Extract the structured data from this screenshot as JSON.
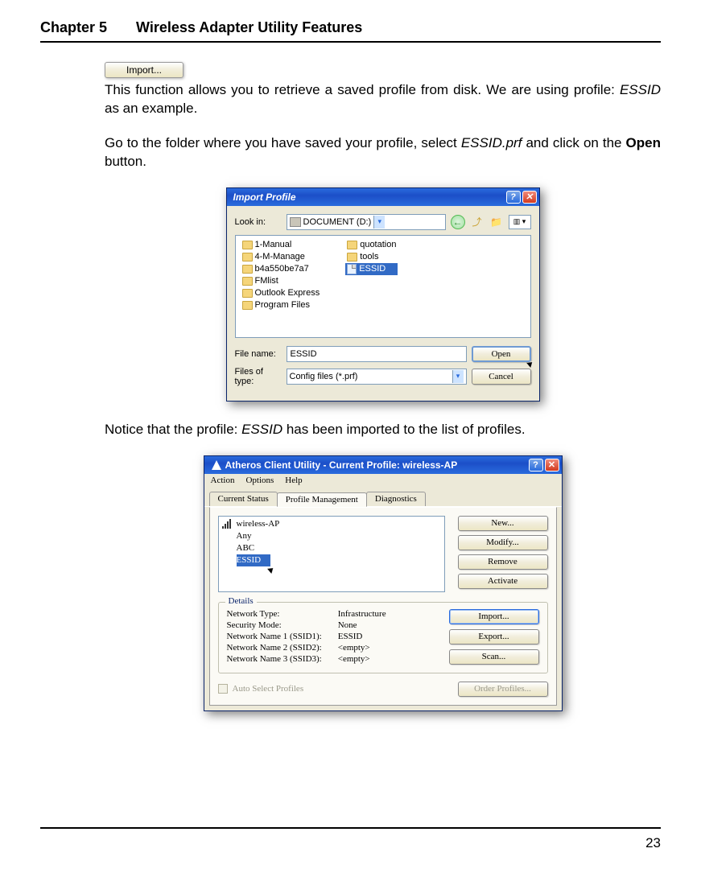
{
  "header": {
    "chapter": "Chapter 5",
    "title": "Wireless Adapter Utility Features"
  },
  "importButton": {
    "label": "Import..."
  },
  "para1": {
    "t1": "This function allows you to retrieve a saved profile from disk. We are using profile: ",
    "essid": "ESSID",
    "t2": " as an example."
  },
  "para2": {
    "t1": "Go to the folder where you have saved your profile, select ",
    "file": "ESSID.prf",
    "t2": " and click on the ",
    "open": "Open",
    "t3": " button."
  },
  "dlg_import": {
    "title": "Import Profile",
    "look_in_lbl": "Look in:",
    "look_in_value": "DOCUMENT (D:)",
    "nav": {
      "view_label": "▥ ▾"
    },
    "files_col1": [
      "1-Manual",
      "4-M-Manage",
      "b4a550be7a7",
      "FMlist",
      "Outlook Express",
      "Program Files"
    ],
    "files_col2_folders": [
      "quotation",
      "tools"
    ],
    "files_col2_selected": "ESSID",
    "filename_lbl": "File name:",
    "filename_value": "ESSID",
    "filetype_lbl": "Files of type:",
    "filetype_value": "Config files (*.prf)",
    "open_btn": "Open",
    "cancel_btn": "Cancel"
  },
  "para3": {
    "t1": "Notice that the profile: ",
    "essid": "ESSID",
    "t2": " has been imported to the list of profiles."
  },
  "dlg_acu": {
    "title": "Atheros Client Utility - Current Profile: wireless-AP",
    "menus": [
      "Action",
      "Options",
      "Help"
    ],
    "tabs": [
      "Current Status",
      "Profile Management",
      "Diagnostics"
    ],
    "profiles": [
      "wireless-AP",
      "Any",
      "ABC"
    ],
    "profile_selected": "ESSID",
    "btns_main": [
      "New...",
      "Modify...",
      "Remove",
      "Activate"
    ],
    "details_title": "Details",
    "details_labels": [
      "Network Type:",
      "Security Mode:",
      "Network Name 1 (SSID1):",
      "Network Name 2 (SSID2):",
      "Network Name 3 (SSID3):"
    ],
    "details_values": [
      "Infrastructure",
      "None",
      "ESSID",
      "<empty>",
      "<empty>"
    ],
    "btns_side": [
      "Import...",
      "Export...",
      "Scan..."
    ],
    "auto_select": "Auto Select Profiles",
    "order_btn": "Order Profiles..."
  },
  "page_number": "23"
}
